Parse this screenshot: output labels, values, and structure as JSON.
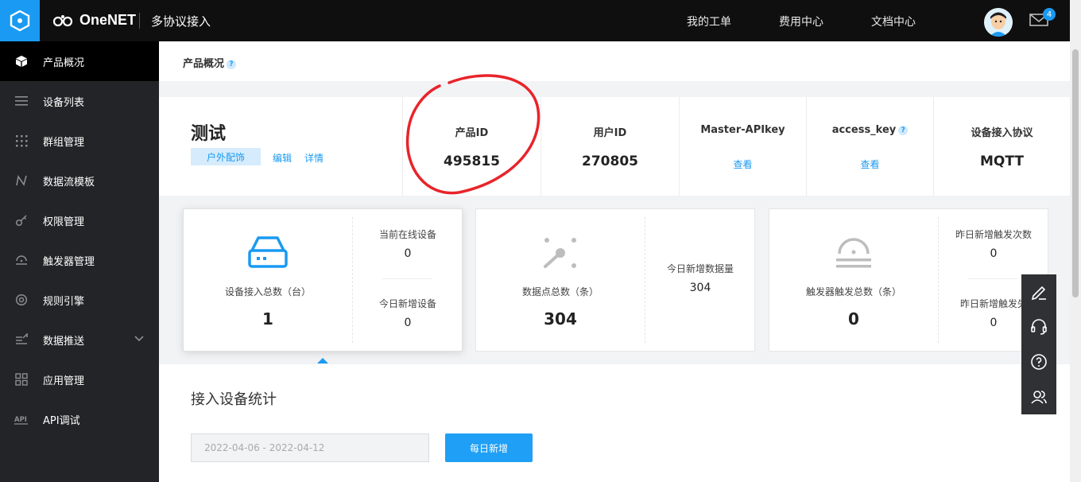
{
  "header": {
    "brand": "OneNET",
    "product": "多协议接入",
    "nav": [
      "我的工单",
      "费用中心",
      "文档中心"
    ],
    "mail_badge": "4",
    "accent": "#1a9af2"
  },
  "sidebar": {
    "items": [
      {
        "label": "产品概况",
        "icon": "cube-icon"
      },
      {
        "label": "设备列表",
        "icon": "list-icon"
      },
      {
        "label": "群组管理",
        "icon": "grid-dots-icon"
      },
      {
        "label": "数据流模板",
        "icon": "flow-icon"
      },
      {
        "label": "权限管理",
        "icon": "key-icon"
      },
      {
        "label": "触发器管理",
        "icon": "trigger-icon"
      },
      {
        "label": "规则引擎",
        "icon": "target-icon"
      },
      {
        "label": "数据推送",
        "icon": "push-icon"
      },
      {
        "label": "应用管理",
        "icon": "apps-icon"
      },
      {
        "label": "API调试",
        "icon": "api-icon"
      }
    ]
  },
  "page": {
    "title": "产品概况",
    "help": "?"
  },
  "product": {
    "name": "测试",
    "tag": "户外配饰",
    "edit": "编辑",
    "details": "详情",
    "fields": [
      {
        "label": "产品ID",
        "value": "495815"
      },
      {
        "label": "用户ID",
        "value": "270805"
      },
      {
        "label": "Master-APIkey",
        "link": "查看"
      },
      {
        "label": "access_key",
        "link": "查看"
      },
      {
        "label": "设备接入协议",
        "value": "MQTT"
      }
    ]
  },
  "stats": {
    "devices": {
      "label": "设备接入总数（台）",
      "value": "1",
      "online_label": "当前在线设备",
      "online_value": "0",
      "new_label": "今日新增设备",
      "new_value": "0"
    },
    "datapoints": {
      "label": "数据点总数（条）",
      "value": "304",
      "new_label": "今日新增数据量",
      "new_value": "304"
    },
    "triggers": {
      "label": "触发器触发总数（条）",
      "value": "0",
      "y_label": "昨日新增触发次数",
      "y_value": "0",
      "fail_label": "昨日新增触发失",
      "fail_value": "0"
    }
  },
  "devices_stats": {
    "title": "接入设备统计",
    "date_range": "2022-04-06 - 2022-04-12",
    "daily_button": "每日新增"
  }
}
